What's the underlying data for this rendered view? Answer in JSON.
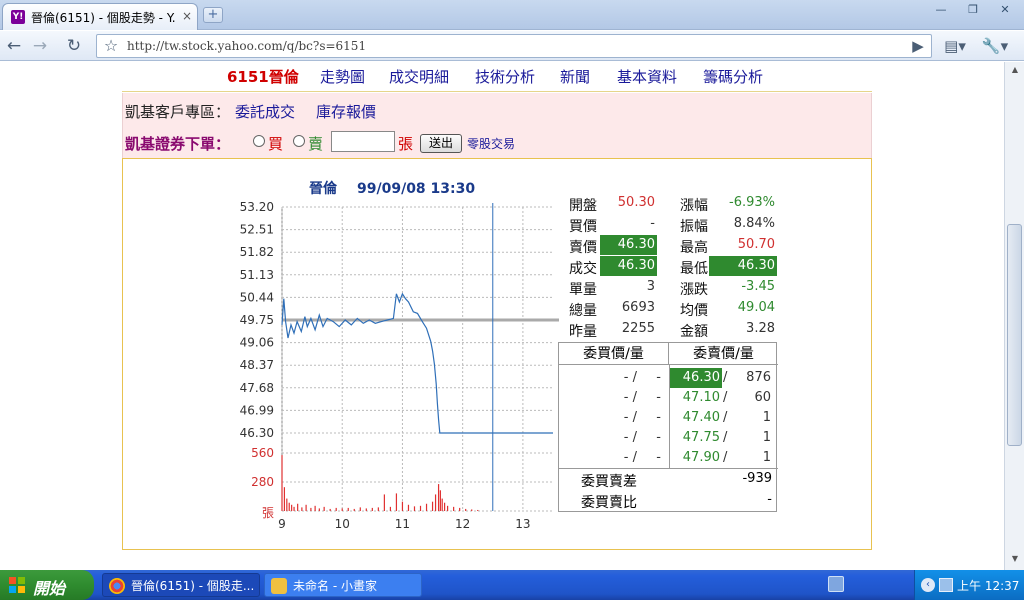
{
  "browser": {
    "tab_title": "晉倫(6151) - 個股走勢 - Y...",
    "tab_close": "×",
    "new_tab": "+",
    "url": "http://tw.stock.yahoo.com/q/bc?s=6151"
  },
  "stock_nav": {
    "symbol": "6151晉倫",
    "items": [
      "走勢圖",
      "成交明細",
      "技術分析",
      "新聞",
      "基本資料",
      "籌碼分析"
    ]
  },
  "broker": {
    "area_label": "凱基客戶專區：",
    "link_entrust": "委託成交",
    "link_inventory": "庫存報價",
    "order_label": "凱基證券下單：",
    "buy_label": "買",
    "sell_label": "賣",
    "qty_value": "",
    "qty_unit": "張",
    "submit_label": "送出",
    "odd_lot_label": "零股交易"
  },
  "chart_data": {
    "type": "line",
    "title": "晉倫",
    "datetime": "99/09/08 13:30",
    "y_ticks": [
      "53.20",
      "52.51",
      "51.82",
      "51.13",
      "50.44",
      "49.75",
      "49.06",
      "48.37",
      "47.68",
      "46.99",
      "46.30"
    ],
    "ylim": [
      46.3,
      53.2
    ],
    "reference_price": 49.75,
    "x_ticks": [
      "9",
      "10",
      "11",
      "12",
      "13"
    ],
    "xlim": [
      9.0,
      13.5
    ],
    "current_time": 12.5,
    "price_series": [
      [
        9.0,
        49.6
      ],
      [
        9.03,
        50.4
      ],
      [
        9.06,
        49.7
      ],
      [
        9.1,
        49.2
      ],
      [
        9.15,
        49.6
      ],
      [
        9.2,
        49.35
      ],
      [
        9.25,
        49.7
      ],
      [
        9.32,
        49.4
      ],
      [
        9.38,
        49.85
      ],
      [
        9.42,
        49.55
      ],
      [
        9.48,
        49.8
      ],
      [
        9.55,
        49.45
      ],
      [
        9.62,
        49.9
      ],
      [
        9.68,
        49.55
      ],
      [
        9.75,
        49.8
      ],
      [
        9.85,
        49.7
      ],
      [
        9.95,
        49.55
      ],
      [
        10.05,
        49.75
      ],
      [
        10.15,
        49.6
      ],
      [
        10.25,
        49.8
      ],
      [
        10.35,
        49.65
      ],
      [
        10.45,
        49.75
      ],
      [
        10.55,
        49.65
      ],
      [
        10.65,
        49.7
      ],
      [
        10.75,
        49.75
      ],
      [
        10.85,
        49.8
      ],
      [
        10.9,
        50.55
      ],
      [
        10.95,
        50.3
      ],
      [
        11.0,
        50.55
      ],
      [
        11.05,
        50.4
      ],
      [
        11.1,
        50.3
      ],
      [
        11.18,
        50.0
      ],
      [
        11.25,
        49.95
      ],
      [
        11.33,
        49.7
      ],
      [
        11.4,
        49.5
      ],
      [
        11.47,
        49.1
      ],
      [
        11.5,
        48.8
      ],
      [
        11.53,
        48.4
      ],
      [
        11.56,
        47.8
      ],
      [
        11.58,
        47.2
      ],
      [
        11.6,
        46.7
      ],
      [
        11.62,
        46.3
      ],
      [
        13.5,
        46.3
      ]
    ],
    "volume_ticks": [
      "560",
      "280",
      "張"
    ],
    "volume_max": 560,
    "volume_series": [
      [
        9.0,
        540
      ],
      [
        9.04,
        230
      ],
      [
        9.08,
        120
      ],
      [
        9.12,
        80
      ],
      [
        9.16,
        60
      ],
      [
        9.2,
        40
      ],
      [
        9.26,
        70
      ],
      [
        9.33,
        35
      ],
      [
        9.4,
        60
      ],
      [
        9.48,
        30
      ],
      [
        9.55,
        50
      ],
      [
        9.62,
        25
      ],
      [
        9.7,
        40
      ],
      [
        9.8,
        20
      ],
      [
        9.9,
        30
      ],
      [
        10.0,
        25
      ],
      [
        10.1,
        30
      ],
      [
        10.2,
        20
      ],
      [
        10.3,
        35
      ],
      [
        10.4,
        25
      ],
      [
        10.5,
        30
      ],
      [
        10.6,
        35
      ],
      [
        10.7,
        160
      ],
      [
        10.8,
        40
      ],
      [
        10.9,
        170
      ],
      [
        11.0,
        90
      ],
      [
        11.1,
        60
      ],
      [
        11.2,
        45
      ],
      [
        11.3,
        50
      ],
      [
        11.4,
        70
      ],
      [
        11.5,
        90
      ],
      [
        11.55,
        160
      ],
      [
        11.6,
        260
      ],
      [
        11.63,
        200
      ],
      [
        11.66,
        120
      ],
      [
        11.7,
        80
      ],
      [
        11.75,
        50
      ],
      [
        11.85,
        40
      ],
      [
        11.95,
        30
      ],
      [
        12.05,
        20
      ],
      [
        12.15,
        15
      ],
      [
        12.25,
        10
      ]
    ]
  },
  "quote": {
    "open_label": "開盤",
    "open": "50.30",
    "bid_label": "買價",
    "bid": "-",
    "ask_label": "賣價",
    "ask": "46.30",
    "last_label": "成交",
    "last": "46.30",
    "tick_vol_label": "單量",
    "tick_vol": "3",
    "total_vol_label": "總量",
    "total_vol": "6693",
    "prev_vol_label": "昨量",
    "prev_vol": "2255",
    "change_pct_label": "漲幅",
    "change_pct": "-6.93%",
    "amplitude_label": "振幅",
    "amplitude": "8.84%",
    "high_label": "最高",
    "high": "50.70",
    "low_label": "最低",
    "low": "46.30",
    "change_label": "漲跌",
    "change": "-3.45",
    "avg_label": "均價",
    "avg": "49.04",
    "amount_label": "金額",
    "amount": "3.28"
  },
  "order_book": {
    "bid_header": "委買價/量",
    "ask_header": "委賣價/量",
    "rows": [
      {
        "bid_price": "-",
        "bid_qty": "-",
        "ask_price": "46.30",
        "ask_qty": "876"
      },
      {
        "bid_price": "-",
        "bid_qty": "-",
        "ask_price": "47.10",
        "ask_qty": "60"
      },
      {
        "bid_price": "-",
        "bid_qty": "-",
        "ask_price": "47.40",
        "ask_qty": "1"
      },
      {
        "bid_price": "-",
        "bid_qty": "-",
        "ask_price": "47.75",
        "ask_qty": "1"
      },
      {
        "bid_price": "-",
        "bid_qty": "-",
        "ask_price": "47.90",
        "ask_qty": "1"
      }
    ],
    "diff_label": "委買賣差",
    "diff": "-939",
    "ratio_label": "委買賣比",
    "ratio": "-"
  },
  "taskbar": {
    "start_label": "開始",
    "tasks": [
      "晉倫(6151) - 個股走...",
      "未命名 - 小畫家"
    ],
    "clock": "上午 12:37"
  },
  "colors": {
    "price_line": "#2f6fb8",
    "highlight_green": "#2f8a2f",
    "down_green": "#2f8a2f",
    "up_red": "#d03030",
    "volume_red": "#e03030"
  }
}
